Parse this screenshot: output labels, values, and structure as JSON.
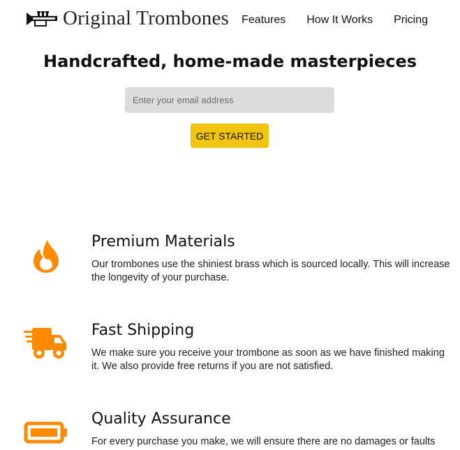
{
  "header": {
    "brand": "Original Trombones",
    "logo_icon": "trumpet-icon",
    "nav": [
      {
        "label": "Features"
      },
      {
        "label": "How It Works"
      },
      {
        "label": "Pricing"
      }
    ]
  },
  "hero": {
    "title": "Handcrafted, home-made masterpieces",
    "email_placeholder": "Enter your email address",
    "cta_label": "GET STARTED"
  },
  "features": [
    {
      "icon": "fire-icon",
      "title": "Premium Materials",
      "description": "Our trombones use the shiniest brass which is sourced locally. This will increase the longevity of your purchase."
    },
    {
      "icon": "shipping-truck-icon",
      "title": "Fast Shipping",
      "description": "We make sure you receive your trombone as soon as we have finished making it. We also provide free returns if you are not satisfied."
    },
    {
      "icon": "battery-icon",
      "title": "Quality Assurance",
      "description": "For every purchase you make, we will ensure there are no damages or faults"
    }
  ],
  "colors": {
    "accent": "#f1c40f",
    "icon_orange": "#ff8a00",
    "input_bg": "#dcdcdc"
  }
}
